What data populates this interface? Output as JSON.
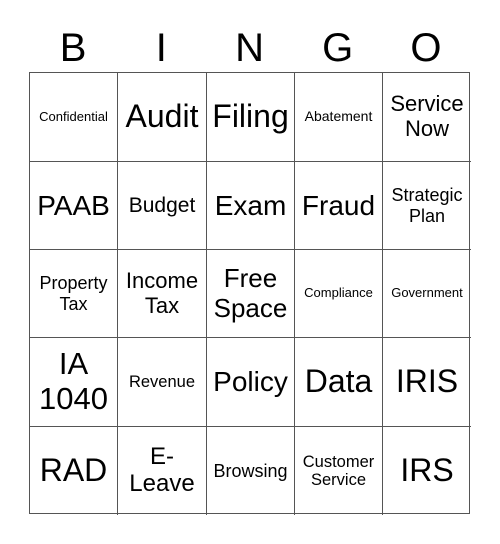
{
  "header": {
    "letters": [
      "B",
      "I",
      "N",
      "G",
      "O"
    ]
  },
  "card": {
    "rows": [
      [
        "Confidential",
        "Audit",
        "Filing",
        "Abatement",
        "Service Now"
      ],
      [
        "PAAB",
        "Budget",
        "Exam",
        "Fraud",
        "Strategic Plan"
      ],
      [
        "Property Tax",
        "Income Tax",
        "Free Space",
        "Compliance",
        "Government"
      ],
      [
        "IA 1040",
        "Revenue",
        "Policy",
        "Data",
        "IRIS"
      ],
      [
        "RAD",
        "E-Leave",
        "Browsing",
        "Customer Service",
        "IRS"
      ]
    ]
  }
}
